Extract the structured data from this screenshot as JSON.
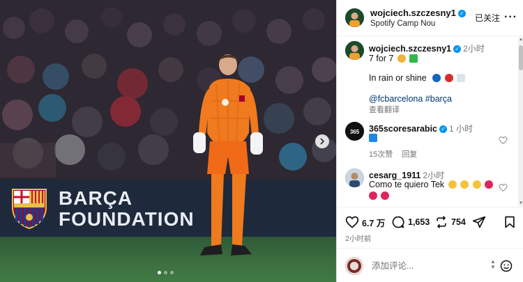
{
  "photo": {
    "board_line1": "BARÇA",
    "board_line2": "FOUNDATION",
    "dots": 3,
    "active_dot": 1
  },
  "post": {
    "username": "wojciech.szczesny1",
    "location": "Spotify Camp Nou",
    "follow_label": "已关注",
    "more_label": "···",
    "caption": {
      "username": "wojciech.szczesny1",
      "time": "2小时",
      "line1": "7 for 7",
      "line2": "In rain or shine",
      "tags": "@fcbarcelona #barça",
      "translate_label": "查看翻译"
    },
    "comments": [
      {
        "username": "365scoresarabic",
        "time": "1 小时",
        "likes": "15次赞",
        "reply_label": "回复"
      },
      {
        "username": "cesarg_1911",
        "time": "2小时",
        "text": "Como te quiero Tek"
      }
    ],
    "actions": {
      "likes": "6.7 万",
      "comments": "1,653",
      "shares": "754"
    },
    "time_ago": "2小时前",
    "comment_placeholder": "添加评论..."
  },
  "colors": {
    "kit_orange": "#f07a1e",
    "verified_blue": "#0095f6",
    "link_blue": "#00376b",
    "board_navy": "#1e2a3c"
  }
}
